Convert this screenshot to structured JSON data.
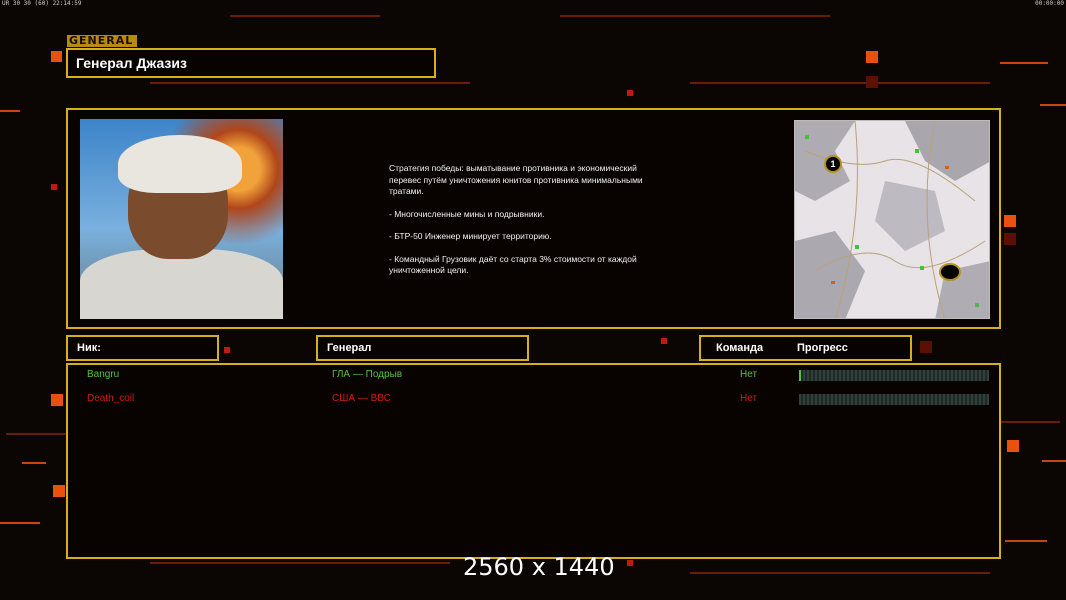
{
  "hud": {
    "left": "UR 30 30 (60) 22:14:59",
    "right": "00:00:00"
  },
  "general": {
    "tag": "GENERAL",
    "name": "Генерал Джазиз"
  },
  "strategy": {
    "paragraphs": [
      "Стратегия победы: выматывание противника и экономический\n перевес путём уничтожения юнитов противника минимальными\n тратами.",
      "- Многочисленные мины и подрывники.",
      "- БТР-50 Инженер минирует территорию.",
      "- Командный Грузовик даёт со старта 3% стоимости от каждой\n уничтоженной цели."
    ]
  },
  "minimap": {
    "start_markers": [
      "1",
      ""
    ]
  },
  "table": {
    "headers": {
      "nick": "Ник:",
      "general": "Генерал",
      "team": "Команда",
      "progress": "Прогресс"
    },
    "players": [
      {
        "nick": "Bangru",
        "general": "ГЛА — Подрыв",
        "team": "Нет",
        "progress": 0.01,
        "color": "#57c23a"
      },
      {
        "nick": "Death_coil",
        "general": "США — ВВС",
        "team": "Нет",
        "progress": 0.0,
        "color": "#d21a12"
      }
    ]
  },
  "watermark": "2560 x 1440",
  "colors": {
    "frame_gold": "#d5b018",
    "accent_orange": "#e8510e",
    "background": "#0b0503"
  }
}
